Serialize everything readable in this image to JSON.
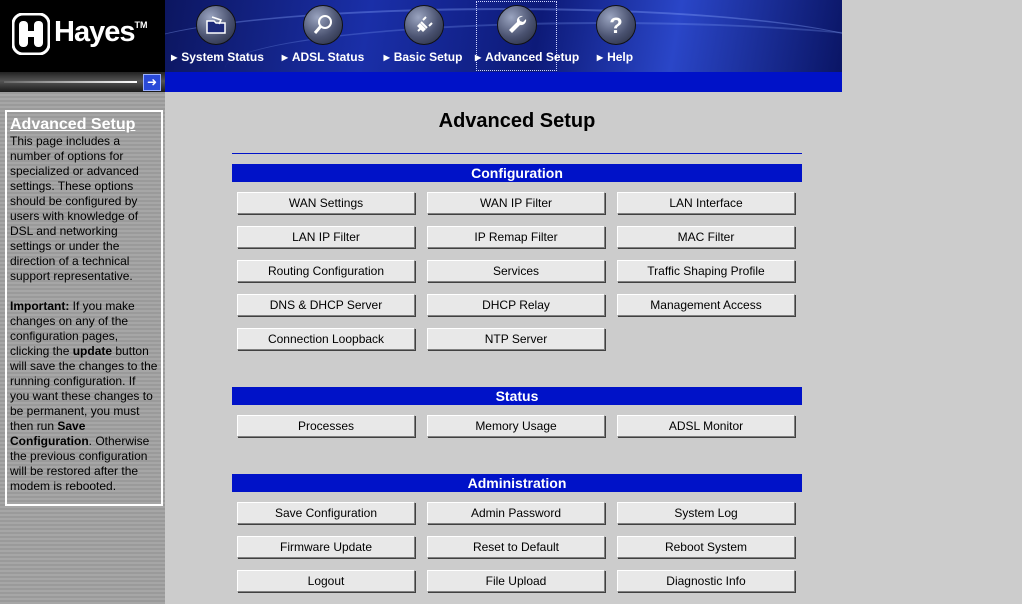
{
  "brand": {
    "name": "Hayes",
    "tm": "TM"
  },
  "nav": [
    {
      "label": "System Status",
      "icon": "folder-icon"
    },
    {
      "label": "ADSL Status",
      "icon": "magnifier-icon"
    },
    {
      "label": "Basic Setup",
      "icon": "plug-icon"
    },
    {
      "label": "Advanced Setup",
      "icon": "wrench-icon",
      "active": true
    },
    {
      "label": "Help",
      "icon": "question-icon"
    }
  ],
  "sidebar": {
    "title": "Advanced Setup",
    "intro": "This page includes a number of options for specialized or advanced settings. These options should be configured by users with knowledge of DSL and networking settings or under the direction of a technical support representative.",
    "important_label": "Important:",
    "important_1": " If you make changes on any of the configuration pages, clicking the ",
    "update_word": "update",
    "important_2": " button will save the changes to the running configuration. If you want these changes to be permanent, you must then run ",
    "save_config_word": "Save Configuration",
    "important_3": ". Otherwise the previous configuration will be restored after the modem is rebooted."
  },
  "main": {
    "title": "Advanced Setup",
    "sections": {
      "configuration": {
        "title": "Configuration",
        "buttons": [
          "WAN Settings",
          "WAN IP Filter",
          "LAN Interface",
          "LAN IP Filter",
          "IP Remap Filter",
          "MAC Filter",
          "Routing Configuration",
          "Services",
          "Traffic Shaping Profile",
          "DNS & DHCP Server",
          "DHCP Relay",
          "Management Access",
          "Connection Loopback",
          "NTP Server"
        ]
      },
      "status": {
        "title": "Status",
        "buttons": [
          "Processes",
          "Memory Usage",
          "ADSL Monitor"
        ]
      },
      "administration": {
        "title": "Administration",
        "buttons": [
          "Save Configuration",
          "Admin Password",
          "System Log",
          "Firmware Update",
          "Reset to Default",
          "Reboot System",
          "Logout",
          "File Upload",
          "Diagnostic Info"
        ]
      }
    }
  },
  "colors": {
    "accent": "#0012c8",
    "background": "#cccccc",
    "header": "#000000"
  }
}
